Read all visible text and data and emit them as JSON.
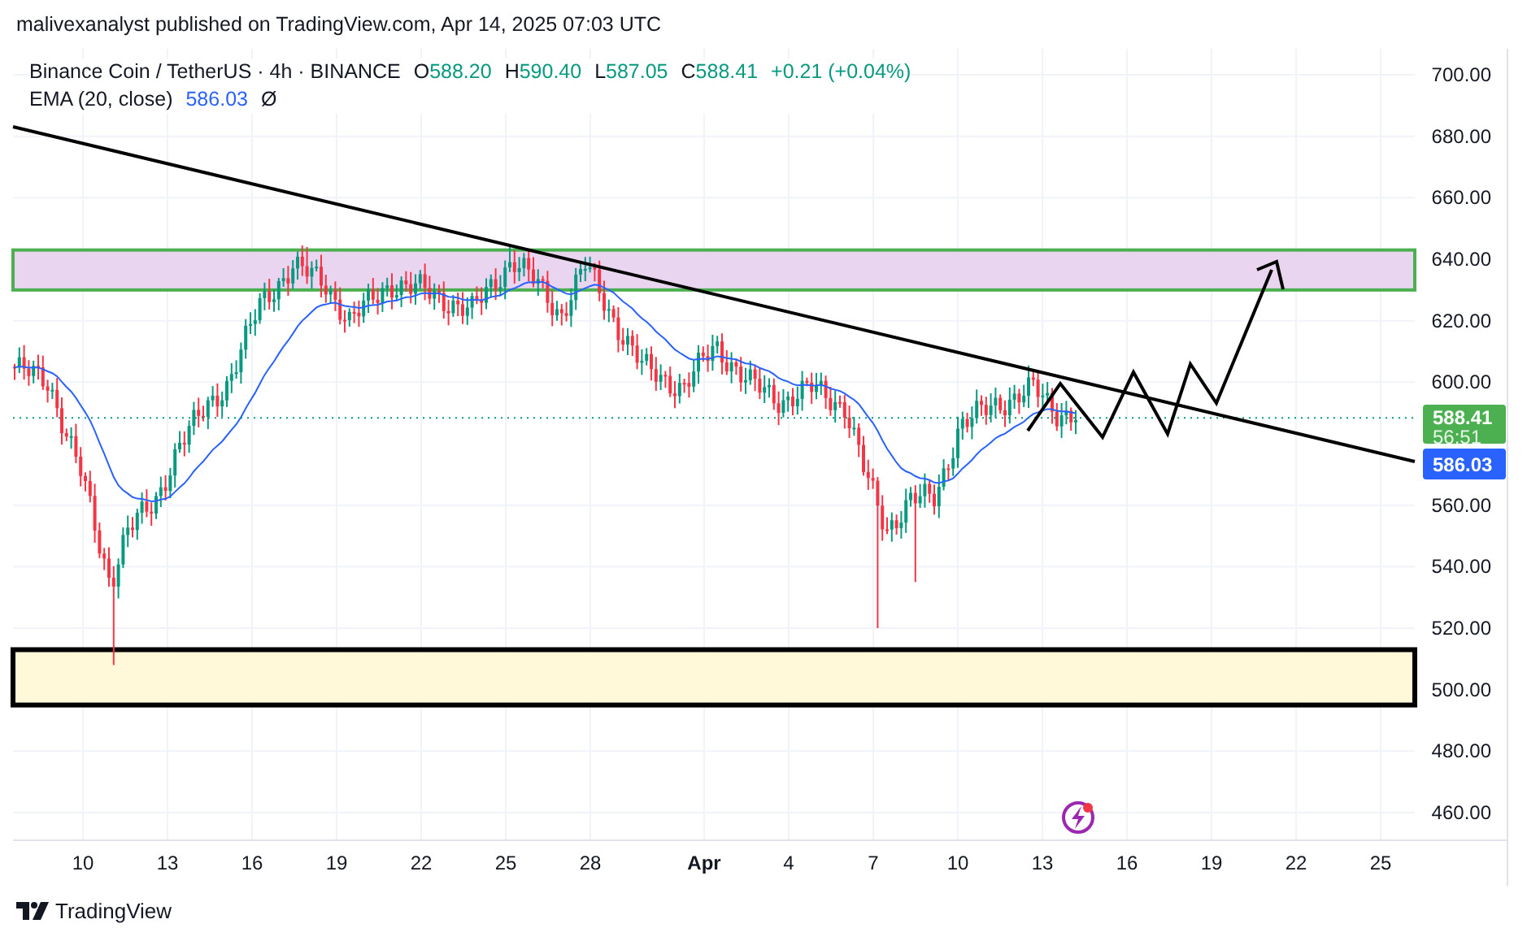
{
  "byline": "malivexanalyst published on TradingView.com, Apr 14, 2025 07:03 UTC",
  "legend": {
    "symbol": "Binance Coin / TetherUS · 4h · BINANCE",
    "ohlc": [
      {
        "label": "O",
        "value": "588.20"
      },
      {
        "label": "H",
        "value": "590.40"
      },
      {
        "label": "L",
        "value": "587.05"
      },
      {
        "label": "C",
        "value": "588.41"
      }
    ],
    "change": "+0.21 (+0.04%)",
    "indicator": {
      "name": "EMA (20, close)",
      "value": "586.03",
      "toggle": "Ø"
    }
  },
  "price_axis": [
    "700.00",
    "680.00",
    "660.00",
    "640.00",
    "620.00",
    "600.00",
    "560.00",
    "540.00",
    "520.00",
    "500.00",
    "480.00",
    "460.00"
  ],
  "price_tags": {
    "last_price": "588.41",
    "countdown": "56:51",
    "ema": "586.03"
  },
  "time_axis": [
    {
      "label": "10",
      "kind": "day"
    },
    {
      "label": "13",
      "kind": "day"
    },
    {
      "label": "16",
      "kind": "day"
    },
    {
      "label": "19",
      "kind": "day"
    },
    {
      "label": "22",
      "kind": "day"
    },
    {
      "label": "25",
      "kind": "day"
    },
    {
      "label": "28",
      "kind": "day"
    },
    {
      "label": "Apr",
      "kind": "month"
    },
    {
      "label": "4",
      "kind": "day"
    },
    {
      "label": "7",
      "kind": "day"
    },
    {
      "label": "10",
      "kind": "day"
    },
    {
      "label": "13",
      "kind": "day"
    },
    {
      "label": "16",
      "kind": "day"
    },
    {
      "label": "19",
      "kind": "day"
    },
    {
      "label": "22",
      "kind": "day"
    },
    {
      "label": "25",
      "kind": "day"
    }
  ],
  "footer": {
    "brand": "TradingView"
  }
}
